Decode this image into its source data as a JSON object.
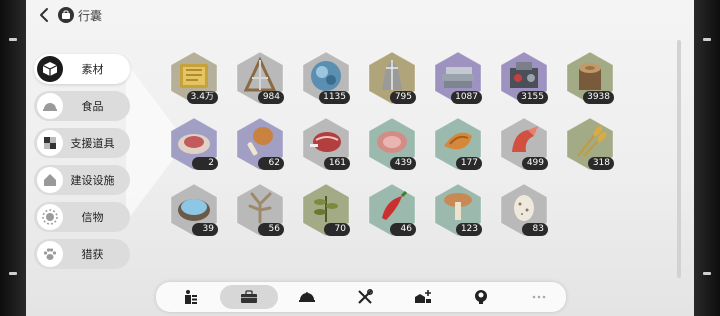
{
  "header": {
    "title": "行囊"
  },
  "sidebar": {
    "items": [
      {
        "label": "素材",
        "icon": "cube-icon",
        "active": true
      },
      {
        "label": "食品",
        "icon": "dish-cover-icon"
      },
      {
        "label": "支援道具",
        "icon": "blocks-icon"
      },
      {
        "label": "建设设施",
        "icon": "house-icon"
      },
      {
        "label": "信物",
        "icon": "sun-token-icon"
      },
      {
        "label": "猎获",
        "icon": "paw-icon"
      }
    ]
  },
  "items": [
    {
      "name": "gold-book",
      "count": "3.4万",
      "bg": "#b6b09a"
    },
    {
      "name": "wood-frame",
      "count": "984",
      "bg": "#b9b9b9"
    },
    {
      "name": "blue-ore",
      "count": "1135",
      "bg": "#b9b9b9"
    },
    {
      "name": "crystal-stone",
      "count": "795",
      "bg": "#b0a47a"
    },
    {
      "name": "metal-bars",
      "count": "1087",
      "bg": "#9e93c0"
    },
    {
      "name": "machine-parts",
      "count": "3155",
      "bg": "#9e93c0"
    },
    {
      "name": "tree-stump",
      "count": "3938",
      "bg": "#a3aa86"
    },
    {
      "name": "raw-meat-plate",
      "count": "2",
      "bg": "#a29fc4"
    },
    {
      "name": "drumstick",
      "count": "62",
      "bg": "#a29fc4"
    },
    {
      "name": "steak",
      "count": "161",
      "bg": "#b9b9b9"
    },
    {
      "name": "ham",
      "count": "439",
      "bg": "#9bb9ad"
    },
    {
      "name": "roast-wing",
      "count": "177",
      "bg": "#9bb9ad"
    },
    {
      "name": "crab-claw",
      "count": "499",
      "bg": "#b9b9b9"
    },
    {
      "name": "wheat",
      "count": "318",
      "bg": "#a3aa86"
    },
    {
      "name": "salt-bowl",
      "count": "39",
      "bg": "#b9b9b9"
    },
    {
      "name": "deer-antler",
      "count": "56",
      "bg": "#b9b9b9"
    },
    {
      "name": "herb",
      "count": "70",
      "bg": "#a3aa86"
    },
    {
      "name": "chili-pepper",
      "count": "46",
      "bg": "#9bb9ad"
    },
    {
      "name": "mushroom",
      "count": "123",
      "bg": "#9bb9ad"
    },
    {
      "name": "egg",
      "count": "83",
      "bg": "#b9b9b9"
    }
  ],
  "toolbar": {
    "items": [
      {
        "icon": "person-bars-icon"
      },
      {
        "icon": "toolbox-icon",
        "active": true
      },
      {
        "icon": "food-cover-icon"
      },
      {
        "icon": "tools-icon"
      },
      {
        "icon": "build-plus-icon"
      },
      {
        "icon": "badge-icon"
      },
      {
        "icon": "more-icon"
      }
    ]
  }
}
